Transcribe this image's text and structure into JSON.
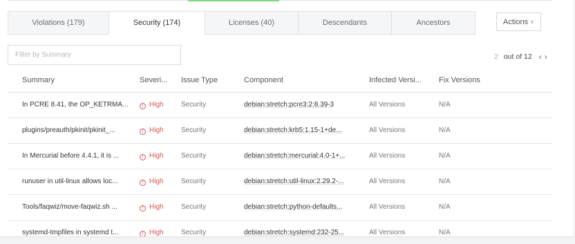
{
  "tabs": [
    {
      "label": "Violations",
      "count": "(179)"
    },
    {
      "label": "Security",
      "count": "(174)"
    },
    {
      "label": "Licenses",
      "count": "(40)"
    },
    {
      "label": "Descendants",
      "count": ""
    },
    {
      "label": "Ancestors",
      "count": ""
    }
  ],
  "actions": {
    "label": "Actions"
  },
  "filter": {
    "placeholder": "Filter by Summary",
    "value": ""
  },
  "pagination": {
    "current": "2",
    "of_text": "out of 12"
  },
  "columns": {
    "summary": "Summary",
    "severity": "Severi...",
    "issue_type": "Issue Type",
    "component": "Component",
    "infected": "Infected Versi...",
    "fix": "Fix Versions"
  },
  "rows": [
    {
      "summary": "In PCRE 8.41, the OP_KETRMA...",
      "severity": "High",
      "type": "Security",
      "component": "debian:stretch:pcre3:2:8.39-3",
      "infected": "All Versions",
      "fix": "N/A"
    },
    {
      "summary": "plugins/preauth/pkinit/pkinit_...",
      "severity": "High",
      "type": "Security",
      "component": "debian:stretch:krb5:1.15-1+de...",
      "infected": "All Versions",
      "fix": "N/A"
    },
    {
      "summary": "In Mercurial before 4.4.1, it is ...",
      "severity": "High",
      "type": "Security",
      "component": "debian:stretch:mercurial:4.0-1+...",
      "infected": "All Versions",
      "fix": "N/A"
    },
    {
      "summary": "runuser in util-linux allows loc...",
      "severity": "High",
      "type": "Security",
      "component": "debian:stretch:util-linux:2.29.2-...",
      "infected": "All Versions",
      "fix": "N/A"
    },
    {
      "summary": "Tools/faqwiz/move-faqwiz.sh ...",
      "severity": "High",
      "type": "Security",
      "component": "debian:stretch:python-defaults...",
      "infected": "All Versions",
      "fix": "N/A"
    },
    {
      "summary": "systemd-tmpfiles in systemd t...",
      "severity": "High",
      "type": "Security",
      "component": "debian:stretch:systemd:232-25...",
      "infected": "All Versions",
      "fix": "N/A"
    }
  ],
  "colors": {
    "accent": "#7bd97e",
    "severity_high": "#d9534f"
  }
}
